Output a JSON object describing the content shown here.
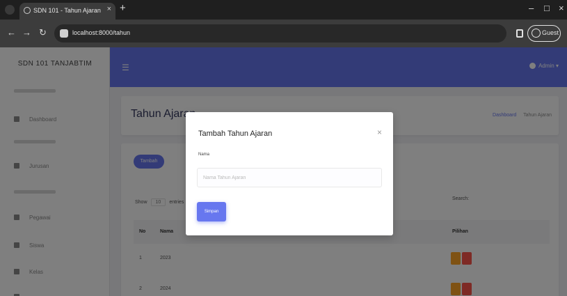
{
  "browser": {
    "tab_title": "SDN 101 - Tahun Ajaran",
    "tab_close": "×",
    "new_tab": "+",
    "url": "localhost:8000/tahun",
    "guest_label": "Guest",
    "back_glyph": "←",
    "forward_glyph": "→",
    "reload_glyph": "↻",
    "minimize_glyph": "–",
    "maximize_glyph": "□",
    "close_glyph": "×"
  },
  "sidebar": {
    "brand": "SDN 101 TANJABTIM",
    "items": [
      {
        "label": "Dashboard",
        "icon": "fire-icon"
      },
      {
        "label": "Jurusan",
        "icon": "grid-icon"
      },
      {
        "label": "Pegawai",
        "icon": "users-icon"
      },
      {
        "label": "Siswa",
        "icon": "user-icon"
      },
      {
        "label": "Kelas",
        "icon": "home-icon"
      }
    ]
  },
  "navbar": {
    "menu_glyph": "☰",
    "user_label": "Admin ▾"
  },
  "header": {
    "title": "Tahun Ajaran",
    "breadcrumb_1": "Dashboard",
    "breadcrumb_2": "Tahun Ajaran"
  },
  "card": {
    "add_button": "Tambah",
    "show_label": "Show",
    "entries_value": "10",
    "entries_label": "entries",
    "search_label": "Search:",
    "columns": [
      "No",
      "Nama",
      "Pilihan"
    ],
    "rows": [
      {
        "no": "1",
        "nama": "2023"
      },
      {
        "no": "2",
        "nama": "2024"
      }
    ]
  },
  "modal": {
    "title": "Tambah Tahun Ajaran",
    "close_glyph": "×",
    "field_label": "Nama",
    "field_placeholder": "Nama Tahun Ajaran",
    "field_value": "",
    "submit_label": "Simpan"
  },
  "colors": {
    "primary": "#6777ef",
    "edit": "#ffa426",
    "delete": "#fc544b"
  }
}
